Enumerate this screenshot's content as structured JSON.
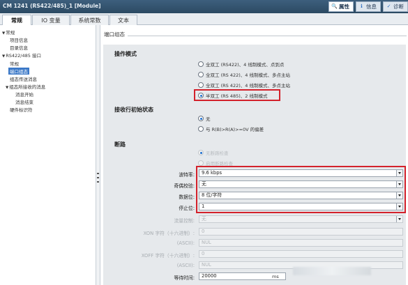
{
  "title_bar": {
    "title": "CM 1241 (RS422/485)_1 [Module]",
    "tabs": [
      {
        "label": "属性",
        "icon": "properties-icon"
      },
      {
        "label": "信息",
        "icon": "info-icon"
      },
      {
        "label": "诊断",
        "icon": "diagnostics-icon"
      }
    ]
  },
  "tabs": [
    {
      "label": "常规"
    },
    {
      "label": "IO 变量"
    },
    {
      "label": "系统常数"
    },
    {
      "label": "文本"
    }
  ],
  "tree": {
    "items": [
      {
        "label": "常规"
      },
      {
        "label": "项目信息"
      },
      {
        "label": "目录信息"
      },
      {
        "label": "RS422/485 接口"
      },
      {
        "label": "常规"
      },
      {
        "label": "端口组态"
      },
      {
        "label": "组态传送消息"
      },
      {
        "label": "组态所接收的消息"
      },
      {
        "label": "消息开始"
      },
      {
        "label": "消息结束"
      },
      {
        "label": "硬件标识符"
      }
    ]
  },
  "main": {
    "header": "端口组态",
    "operation_mode": {
      "title": "操作模式",
      "options": [
        {
          "label": "全双工 (RS422)、4 线制模式、点到点",
          "selected": false
        },
        {
          "label": "全双工 (RS 422)、4 线制模式、多点主站",
          "selected": false
        },
        {
          "label": "全双工 (RS 422)、4 线制模式、多点主站",
          "selected": false
        },
        {
          "label": "半双工 (RS 485)、2 线制模式",
          "selected": true
        }
      ]
    },
    "receive_line": {
      "title": "接收行初始状态",
      "options": [
        {
          "label": "无",
          "selected": true
        },
        {
          "label": "与 R(B)>R(A)>=0V 的偏差",
          "selected": false
        }
      ]
    },
    "break": {
      "title": "断路",
      "options": [
        {
          "label": "无断路检查"
        },
        {
          "label": "启用断路检查"
        }
      ]
    },
    "fields": {
      "baud_label": "波特率:",
      "baud_value": "9.6 kbps",
      "parity_label": "奇偶校验:",
      "parity_value": "无",
      "databits_label": "数据位:",
      "databits_value": "8 位/字符",
      "stopbits_label": "停止位:",
      "stopbits_value": "1",
      "flow_label": "流量控制:",
      "flow_value": "无",
      "xon_label": "XON 字符（十六进制）:",
      "xon_value": "0",
      "xon_ascii_label": "(ASCII):",
      "xon_ascii_value": "NUL",
      "xoff_label": "XOFF 字符（十六进制）:",
      "xoff_value": "0",
      "xoff_ascii_label": "(ASCII):",
      "xoff_ascii_value": "NUL",
      "wait_label": "等待时间:",
      "wait_value": "20000",
      "wait_unit": "ms"
    }
  },
  "colors": {
    "highlight_border": "#d3212b",
    "selection": "#3b78c7",
    "title_bar": "#2c4a63"
  }
}
